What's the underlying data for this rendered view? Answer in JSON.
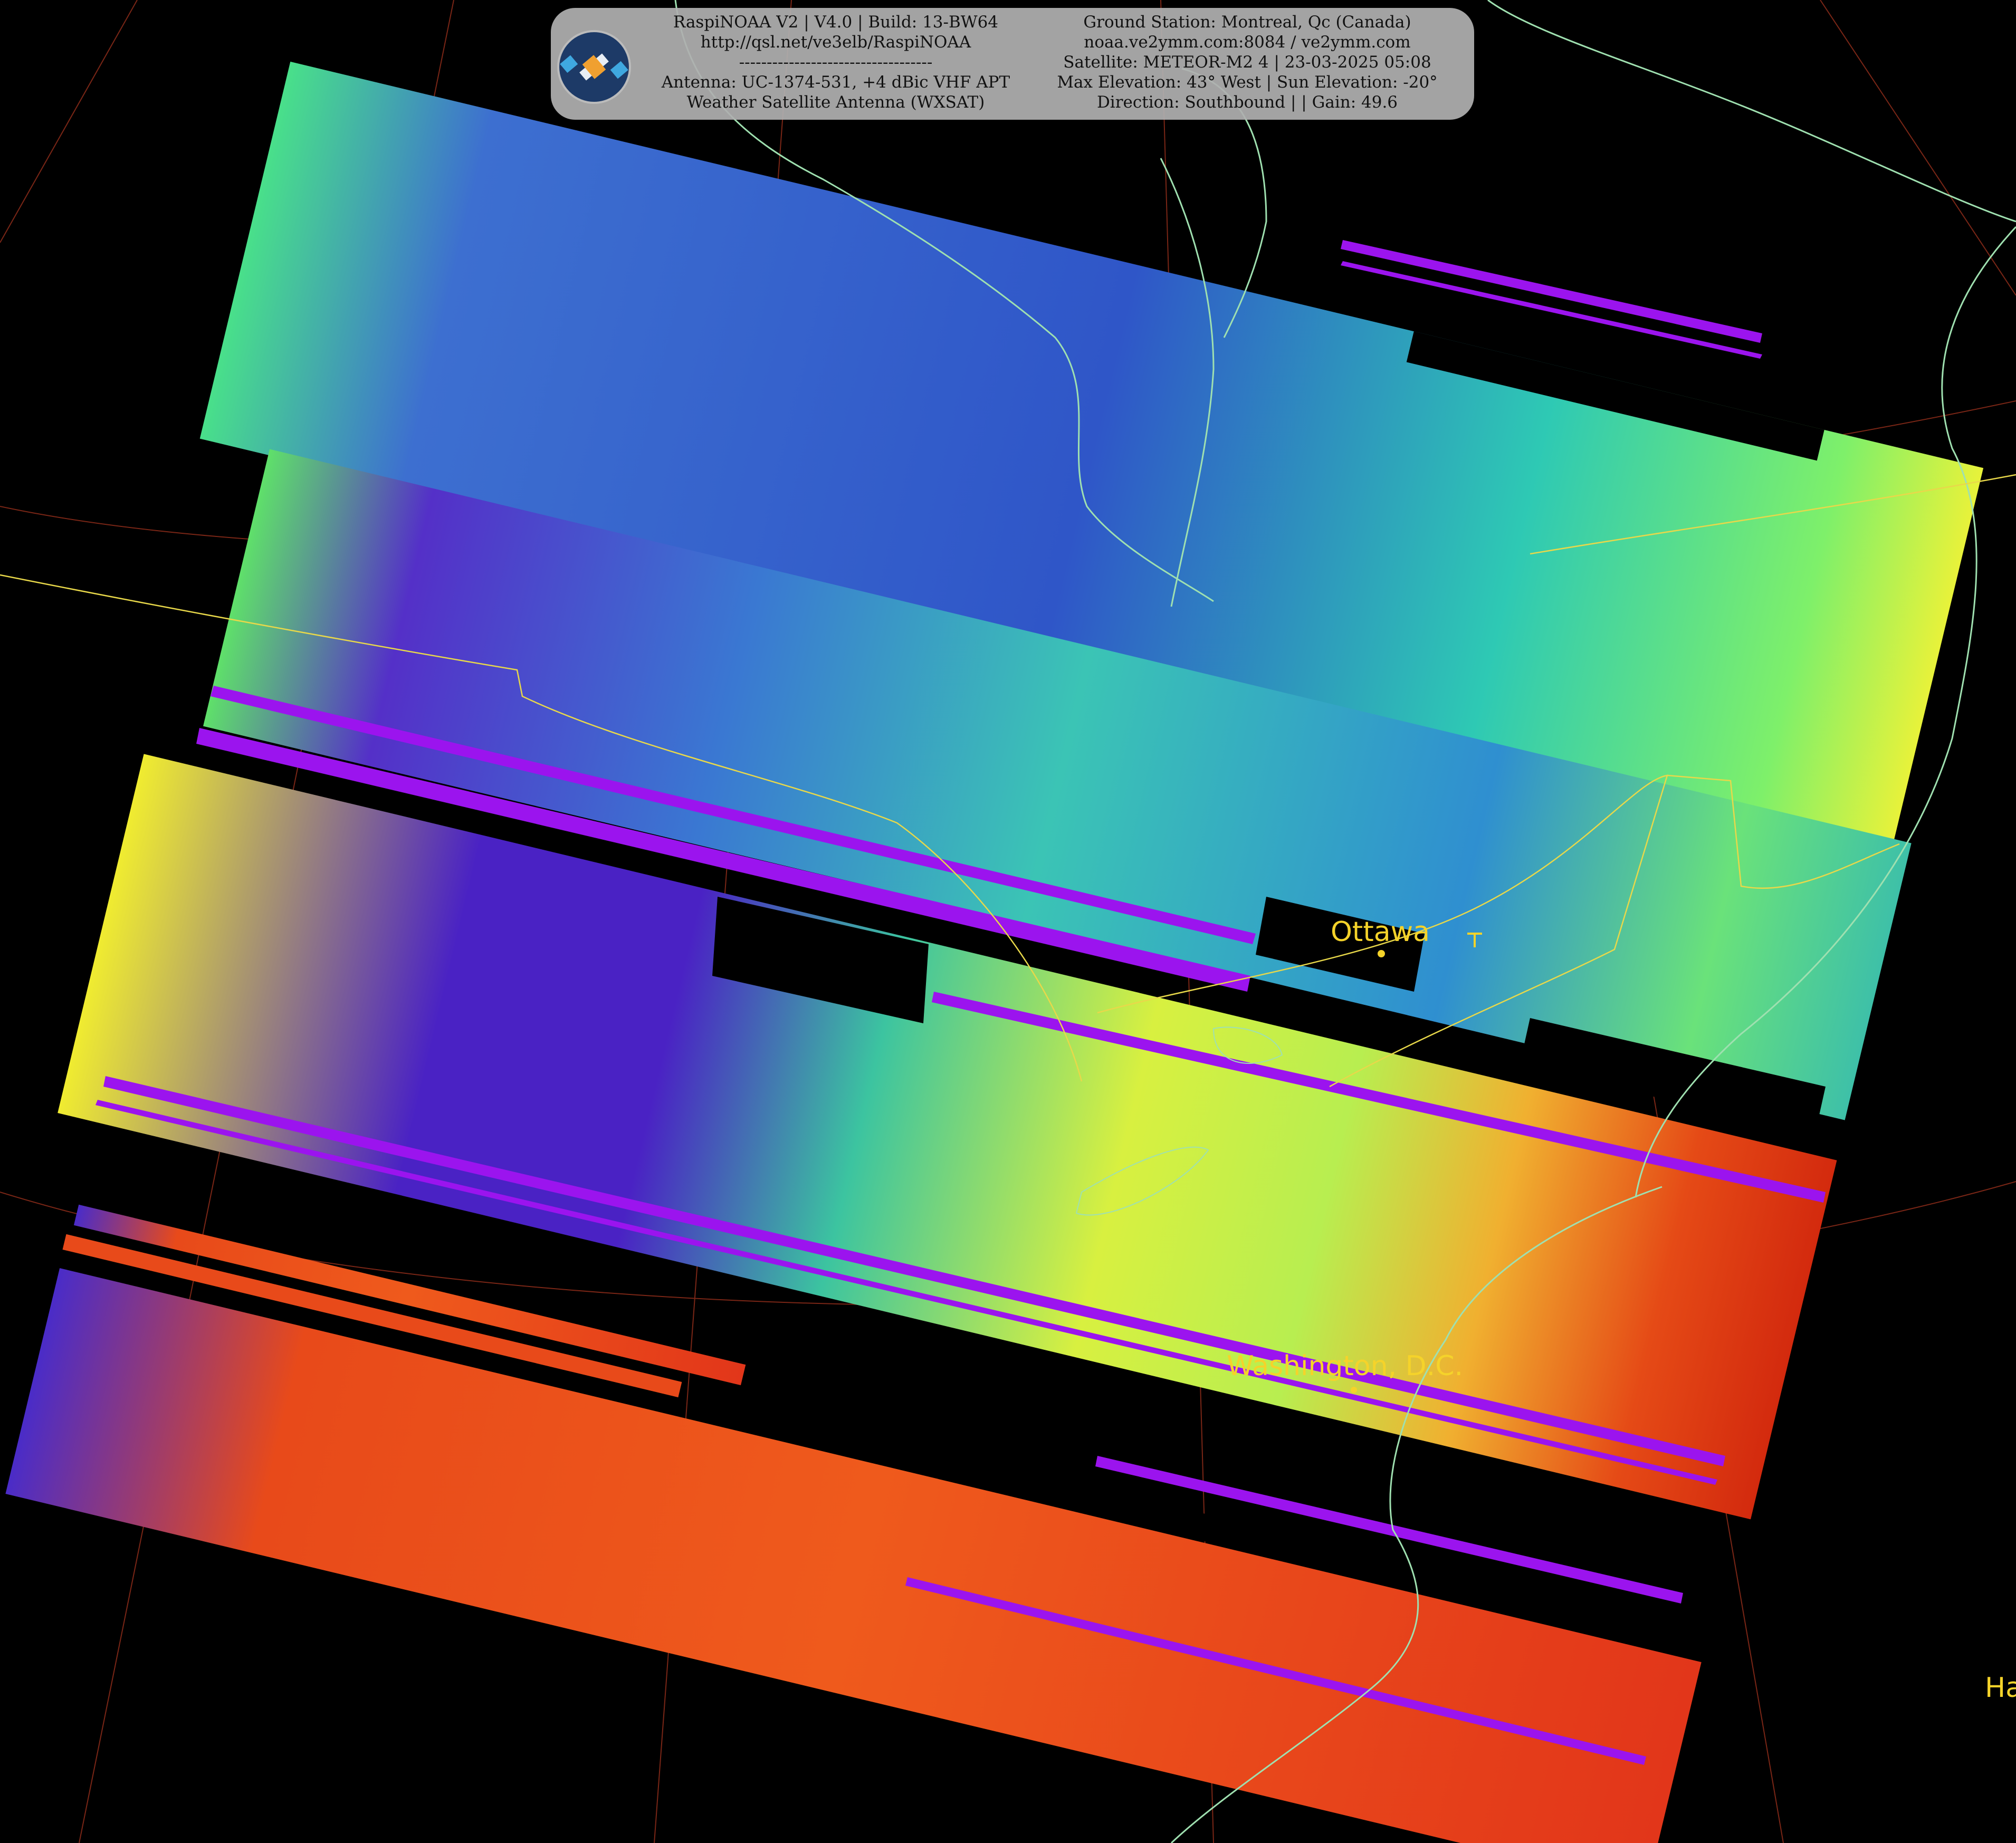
{
  "header": {
    "left_lines": [
      "RaspiNOAA V2 | V4.0 | Build: 13-BW64",
      "http://qsl.net/ve3elb/RaspiNOAA",
      "-----------------------------------",
      "Antenna: UC-1374-531, +4 dBic VHF APT",
      "Weather Satellite Antenna (WXSAT)"
    ],
    "right_lines": [
      "Ground Station: Montreal, Qc (Canada)",
      "noaa.ve2ymm.com:8084 / ve2ymm.com",
      "Satellite: METEOR-M2 4 | 23-03-2025 05:08",
      "Max Elevation: 43° West | Sun Elevation: -20°",
      "Direction: Southbound | | Gain: 49.6"
    ],
    "logo_icon": "satellite-icon"
  },
  "cities": {
    "ottawa": "Ottawa",
    "washington": "Washington, D.C.",
    "partial": "Ha"
  },
  "colors": {
    "coastline": "#9fe0b0",
    "border": "#e8d84a",
    "graticule": "#8a2a1a",
    "label": "#f5d32a"
  }
}
